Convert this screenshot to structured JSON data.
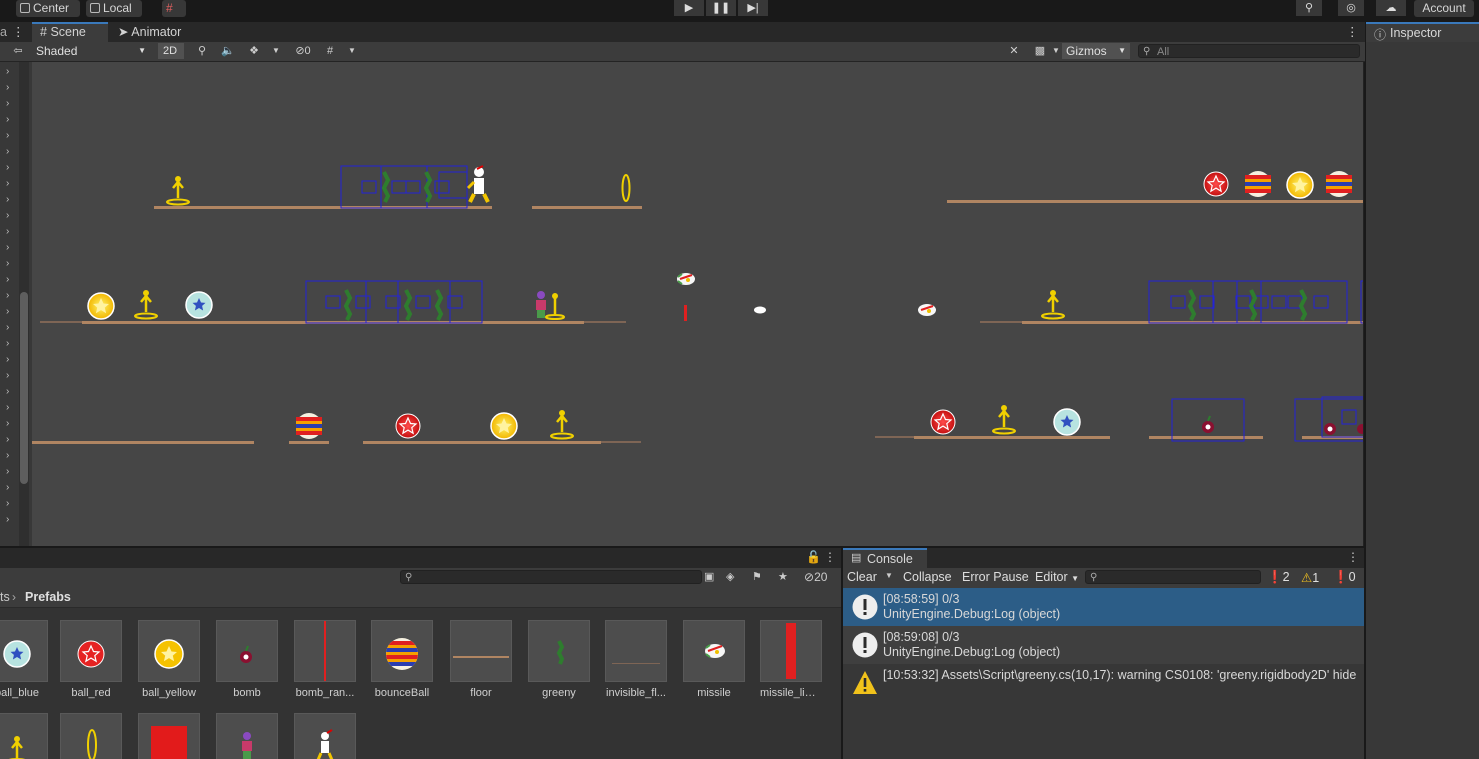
{
  "topbar": {
    "pivot_label": "Center",
    "space_label": "Local",
    "account_label": "Account"
  },
  "scene": {
    "tab_scene": "Scene",
    "tab_animator": "Animator",
    "draw_mode": "Shaded",
    "toggle_2d": "2D",
    "hidden_count": "0",
    "gizmos_label": "Gizmos",
    "search_placeholder": "All"
  },
  "inspector": {
    "tab_label": "Inspector"
  },
  "project": {
    "breadcrumb_parent": "ts",
    "breadcrumb_current": "Prefabs",
    "hidden_count": "20",
    "assets": [
      {
        "label": "ball_blue",
        "kind": "ball-blue"
      },
      {
        "label": "ball_red",
        "kind": "ball-red"
      },
      {
        "label": "ball_yellow",
        "kind": "ball-yellow"
      },
      {
        "label": "bomb",
        "kind": "bomb"
      },
      {
        "label": "bomb_ran...",
        "kind": "bomb-range"
      },
      {
        "label": "bounceBall",
        "kind": "bounce-ball"
      },
      {
        "label": "floor",
        "kind": "floor"
      },
      {
        "label": "greeny",
        "kind": "greeny"
      },
      {
        "label": "invisible_fl...",
        "kind": "invisible-floor"
      },
      {
        "label": "missile",
        "kind": "missile"
      },
      {
        "label": "missile_limi...",
        "kind": "missile-limit"
      }
    ]
  },
  "console": {
    "tab_label": "Console",
    "clear_label": "Clear",
    "collapse_label": "Collapse",
    "error_pause_label": "Error Pause",
    "editor_label": "Editor",
    "count_logs": "2",
    "count_warnings": "1",
    "count_errors": "0",
    "entries": [
      {
        "type": "log",
        "line1": "[08:58:59] 0/3",
        "line2": "UnityEngine.Debug:Log (object)",
        "selected": true
      },
      {
        "type": "log",
        "line1": "[08:59:08] 0/3",
        "line2": "UnityEngine.Debug:Log (object)",
        "selected": false
      },
      {
        "type": "warning",
        "line1": "[10:53:32] Assets\\Script\\greeny.cs(10,17): warning CS0108: 'greeny.rigidbody2D' hide",
        "line2": "",
        "selected": false
      }
    ]
  },
  "colors": {
    "selection": "#2c5d87",
    "floor": "#b08562",
    "collider": "#2323d8",
    "accent_tab": "#3a79bb"
  }
}
